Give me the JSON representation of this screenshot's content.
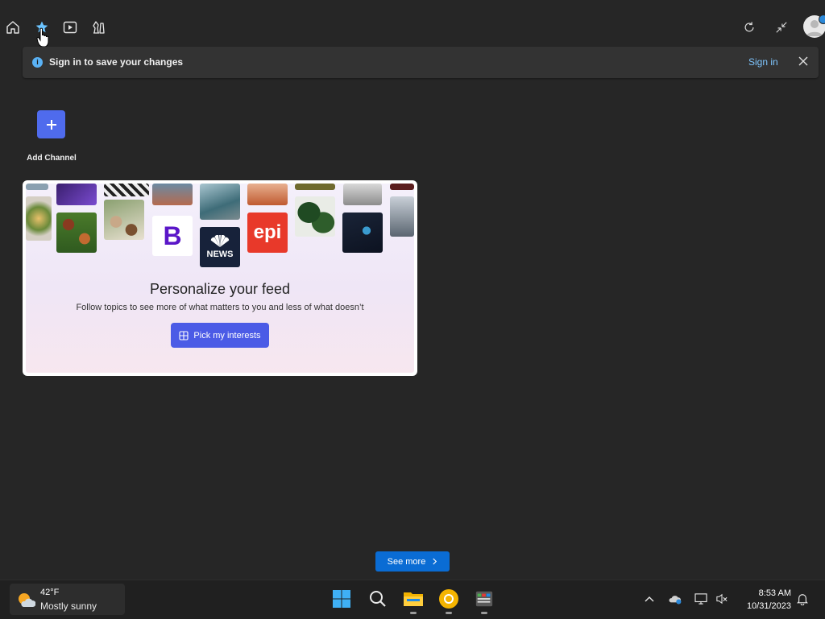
{
  "banner": {
    "message": "Sign in to save your changes",
    "signin_label": "Sign in"
  },
  "add_channel": {
    "label": "Add Channel"
  },
  "card": {
    "title": "Personalize your feed",
    "subtitle": "Follow topics to see more of what matters to you and less of what doesn’t",
    "button_label": "Pick my interests",
    "logos": {
      "b_letter": "B",
      "nbc_text": "NEWS",
      "epi_text": "epi"
    }
  },
  "see_more_label": "See more",
  "taskbar": {
    "weather_temp": "42°F",
    "weather_desc": "Mostly sunny",
    "time": "8:53 AM",
    "date": "10/31/2023"
  },
  "colors": {
    "accent": "#4f6bed",
    "link": "#7fc6ff",
    "see_more": "#0a6cd4"
  }
}
